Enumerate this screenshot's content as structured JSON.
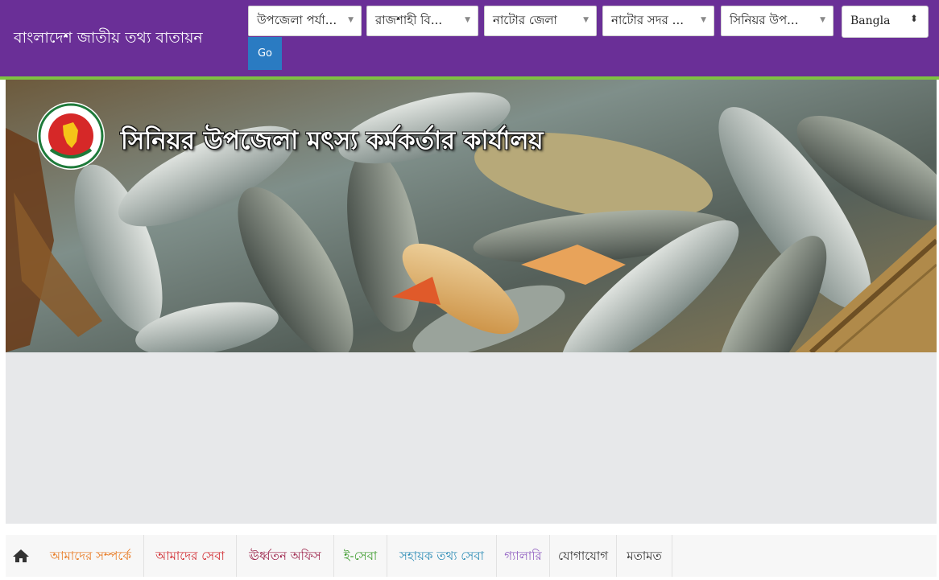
{
  "header": {
    "site_title": "বাংলাদেশ জাতীয় তথ্য বাতায়ন",
    "filters": [
      {
        "value": "উপজেলা পর্যা...",
        "arrow": "▼"
      },
      {
        "value": "রাজশাহী বি...",
        "arrow": "▼"
      },
      {
        "value": "নাটোর জেলা",
        "arrow": "▼"
      },
      {
        "value": "নাটোর সদর ...",
        "arrow": "▼"
      },
      {
        "value": "সিনিয়র উপ...",
        "arrow": "▼"
      }
    ],
    "language": {
      "value": "Bangla",
      "arrow": "⬍"
    },
    "go_label": "Go"
  },
  "banner": {
    "title": "সিনিয়র উপজেলা মৎস্য কর্মকর্তার কার্যালয়",
    "logo_icon": "govt-seal-icon"
  },
  "nav": {
    "home_icon": "home-icon",
    "items": [
      {
        "label": "আমাদের সম্পর্কে",
        "color": "#e8761c"
      },
      {
        "label": "আমাদের সেবা",
        "color": "#d0262c"
      },
      {
        "label": "ঊর্ধ্বতন অফিস",
        "color": "#9b2048"
      },
      {
        "label": "ই-সেবা",
        "color": "#3a9a2a"
      },
      {
        "label": "সহায়ক তথ্য সেবা",
        "color": "#2a8bb5"
      },
      {
        "label": "গ্যালারি",
        "color": "#8e5bc0"
      },
      {
        "label": "যোগাযোগ",
        "color": "#333333"
      },
      {
        "label": "মতামত",
        "color": "#333333"
      }
    ]
  },
  "colors": {
    "header_bg": "#6a2f97",
    "header_border": "#7ec242",
    "go_button": "#2a7bc2",
    "content_bg": "#e7e8ea"
  }
}
